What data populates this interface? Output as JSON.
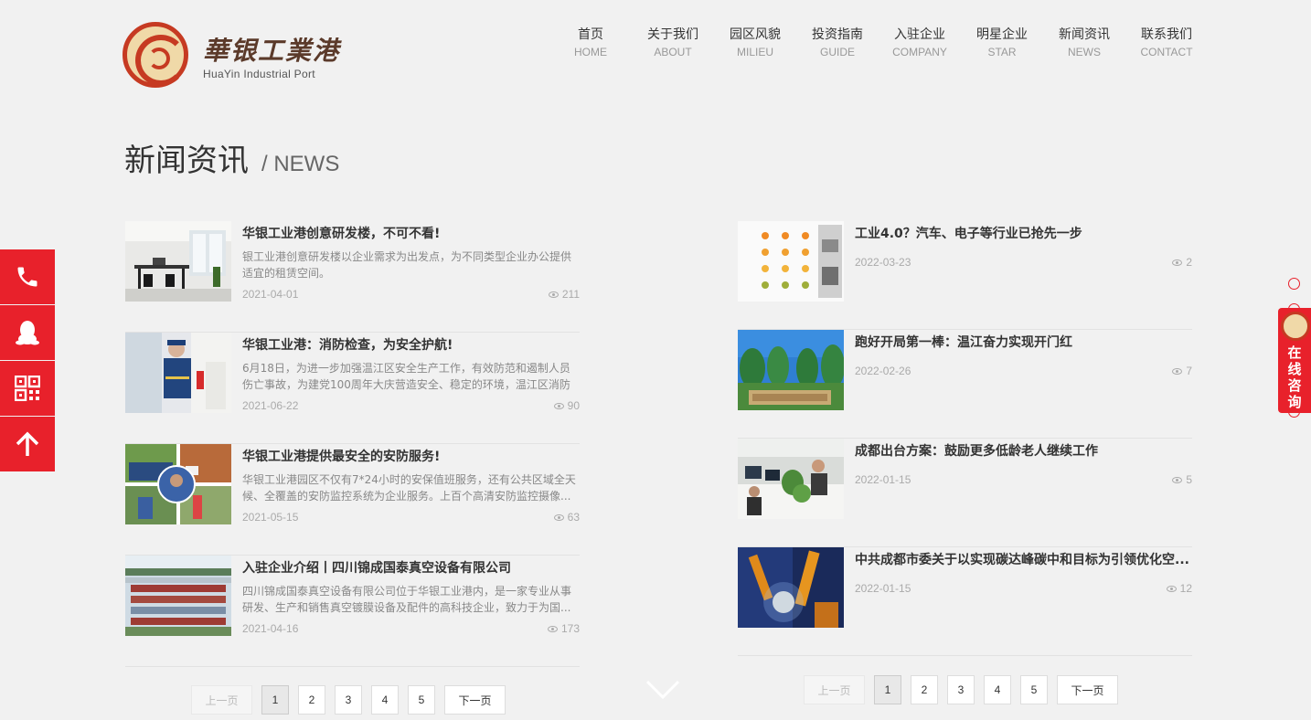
{
  "logo": {
    "cn": "華银工業港",
    "en": "HuaYin Industrial Port"
  },
  "nav": [
    {
      "cn": "首页",
      "en": "HOME"
    },
    {
      "cn": "关于我们",
      "en": "ABOUT"
    },
    {
      "cn": "园区风貌",
      "en": "MILIEU"
    },
    {
      "cn": "投资指南",
      "en": "GUIDE"
    },
    {
      "cn": "入驻企业",
      "en": "COMPANY"
    },
    {
      "cn": "明星企业",
      "en": "STAR"
    },
    {
      "cn": "新闻资讯",
      "en": "NEWS"
    },
    {
      "cn": "联系我们",
      "en": "CONTACT"
    }
  ],
  "page_title": {
    "cn": "新闻资讯",
    "en": "/ NEWS"
  },
  "left_news": [
    {
      "title": "华银工业港创意研发楼，不可不看!",
      "desc": "银工业港创意研发楼以企业需求为出发点，为不同类型企业办公提供适宜的租赁空间。",
      "date": "2021-04-01",
      "views": "211",
      "thumb": "office"
    },
    {
      "title": "华银工业港：消防检查，为安全护航!",
      "desc": "6月18日，为进一步加强温江区安全生产工作，有效防范和遏制人员伤亡事故，为建党100周年大庆营造安全、稳定的环境，温江区消防中...",
      "date": "2021-06-22",
      "views": "90",
      "thumb": "fire"
    },
    {
      "title": "华银工业港提供最安全的安防服务!",
      "desc": "华银工业港园区不仅有7*24小时的安保值班服务，还有公共区域全天候、全覆盖的安防监控系统为企业服务。上百个高清安防监控摄像...",
      "date": "2021-05-15",
      "views": "63",
      "thumb": "security"
    },
    {
      "title": "入驻企业介绍丨四川锦成国泰真空设备有限公司",
      "desc": "四川锦成国泰真空设备有限公司位于华银工业港内，是一家专业从事研发、生产和销售真空镀膜设备及配件的高科技企业，致力于为国...",
      "date": "2021-04-16",
      "views": "173",
      "thumb": "aerial"
    }
  ],
  "right_news": [
    {
      "title": "工业4.0？汽车、电子等行业已抢先一步",
      "date": "2022-03-23",
      "views": "2",
      "thumb": "infographic"
    },
    {
      "title": "跑好开局第一棒：温江奋力实现开门红",
      "date": "2022-02-26",
      "views": "7",
      "thumb": "garden"
    },
    {
      "title": "成都出台方案：鼓励更多低龄老人继续工作",
      "date": "2022-01-15",
      "views": "5",
      "thumb": "workers"
    },
    {
      "title": "中共成都市委关于以实现碳达峰碳中和目标为引领优化空...",
      "date": "2022-01-15",
      "views": "12",
      "thumb": "robot"
    }
  ],
  "pager": {
    "prev": "上一页",
    "next": "下一页",
    "pages": [
      "1",
      "2",
      "3",
      "4",
      "5"
    ],
    "current": "1"
  },
  "side_tools": [
    "phone-icon",
    "qq-icon",
    "qrcode-icon",
    "arrow-up-icon"
  ],
  "consult": {
    "text": "在线咨询"
  },
  "colors": {
    "accent": "#e8212b",
    "logo_red": "#c63a22",
    "logo_gold": "#f0d9a8"
  }
}
